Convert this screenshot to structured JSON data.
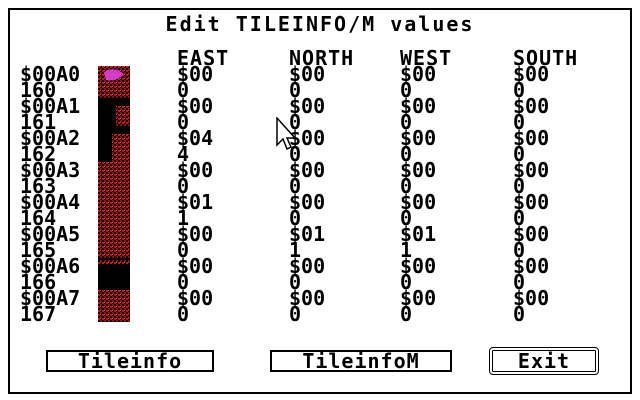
{
  "title": "Edit TILEINFO/M values",
  "headers": [
    "EAST",
    "NORTH",
    "WEST",
    "SOUTH"
  ],
  "rows": [
    {
      "hex": "$00A0",
      "dec": "160",
      "east_hex": "$00",
      "east_dec": "0",
      "north_hex": "$00",
      "north_dec": "0",
      "west_hex": "$00",
      "west_dec": "0",
      "south_hex": "$00",
      "south_dec": "0"
    },
    {
      "hex": "$00A1",
      "dec": "161",
      "east_hex": "$00",
      "east_dec": "0",
      "north_hex": "$00",
      "north_dec": "0",
      "west_hex": "$00",
      "west_dec": "0",
      "south_hex": "$00",
      "south_dec": "0"
    },
    {
      "hex": "$00A2",
      "dec": "162",
      "east_hex": "$04",
      "east_dec": "4",
      "north_hex": "$00",
      "north_dec": "0",
      "west_hex": "$00",
      "west_dec": "0",
      "south_hex": "$00",
      "south_dec": "0"
    },
    {
      "hex": "$00A3",
      "dec": "163",
      "east_hex": "$00",
      "east_dec": "0",
      "north_hex": "$00",
      "north_dec": "0",
      "west_hex": "$00",
      "west_dec": "0",
      "south_hex": "$00",
      "south_dec": "0"
    },
    {
      "hex": "$00A4",
      "dec": "164",
      "east_hex": "$01",
      "east_dec": "1",
      "north_hex": "$00",
      "north_dec": "0",
      "west_hex": "$00",
      "west_dec": "0",
      "south_hex": "$00",
      "south_dec": "0"
    },
    {
      "hex": "$00A5",
      "dec": "165",
      "east_hex": "$00",
      "east_dec": "0",
      "north_hex": "$01",
      "north_dec": "1",
      "west_hex": "$01",
      "west_dec": "1",
      "south_hex": "$00",
      "south_dec": "0"
    },
    {
      "hex": "$00A6",
      "dec": "166",
      "east_hex": "$00",
      "east_dec": "0",
      "north_hex": "$00",
      "north_dec": "0",
      "west_hex": "$00",
      "west_dec": "0",
      "south_hex": "$00",
      "south_dec": "0"
    },
    {
      "hex": "$00A7",
      "dec": "167",
      "east_hex": "$00",
      "east_dec": "0",
      "north_hex": "$00",
      "north_dec": "0",
      "west_hex": "$00",
      "west_dec": "0",
      "south_hex": "$00",
      "south_dec": "0"
    }
  ],
  "buttons": {
    "tileinfo": "Tileinfo",
    "tileinfom": "TileinfoM",
    "exit": "Exit"
  },
  "colors": {
    "tile_red": "#c01818",
    "tile_magenta": "#e040e0",
    "tile_dark": "#000000"
  }
}
